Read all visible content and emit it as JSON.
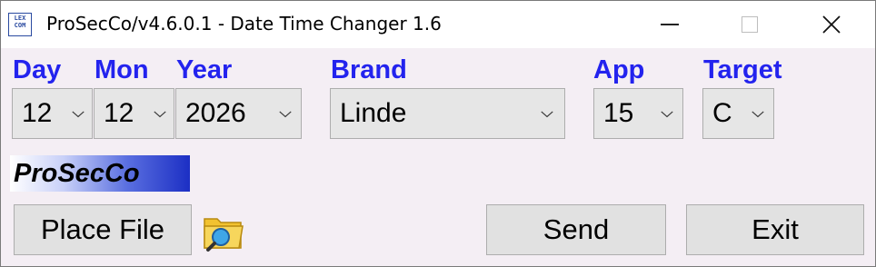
{
  "window": {
    "title": "ProSecCo/v4.6.0.1 - Date Time Changer 1.6",
    "icon_text": "LEX\nCOM",
    "icon": "app-icon",
    "controls": {
      "minimize": "minimize-icon",
      "maximize": "maximize-icon",
      "close": "close-icon"
    }
  },
  "fields": {
    "day": {
      "label": "Day",
      "value": "12"
    },
    "month": {
      "label": "Mon",
      "value": "12"
    },
    "year": {
      "label": "Year",
      "value": "2026"
    },
    "brand": {
      "label": "Brand",
      "value": "Linde"
    },
    "app": {
      "label": "App",
      "value": "15"
    },
    "target": {
      "label": "Target",
      "value": "C"
    }
  },
  "logo_text": "ProSecCo",
  "buttons": {
    "place_file": "Place File",
    "send": "Send",
    "exit": "Exit"
  },
  "icons": {
    "dropdown": "chevron-down-icon",
    "folder": "folder-search-icon"
  },
  "colors": {
    "label_blue": "#2323ee",
    "window_bg": "#f4eef4",
    "control_bg": "#e6e6e6"
  }
}
